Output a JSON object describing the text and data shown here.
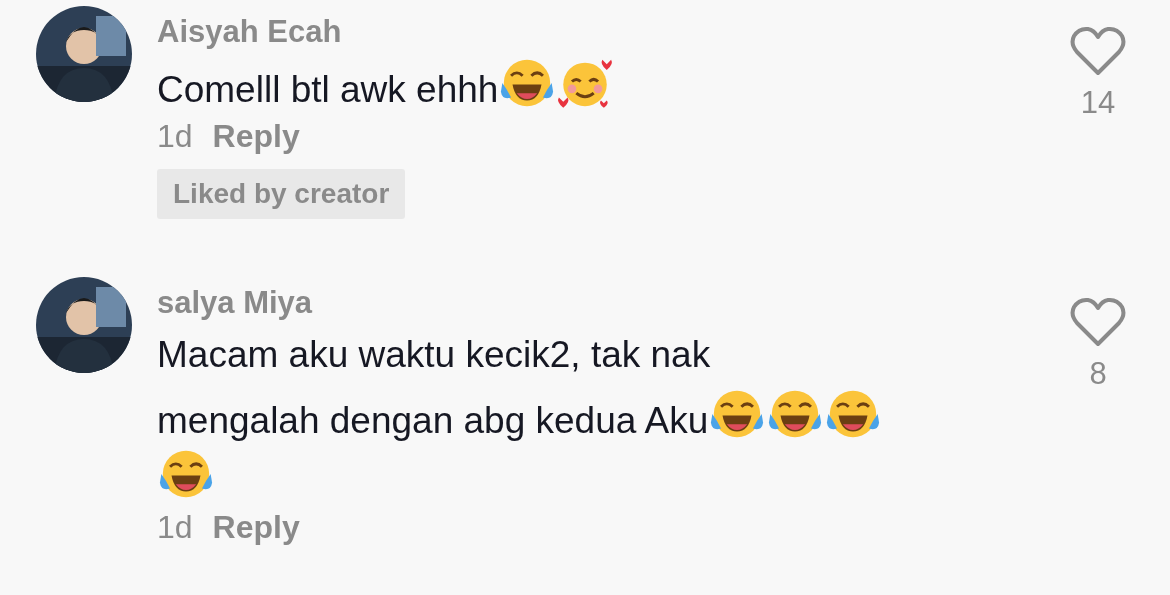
{
  "comments": [
    {
      "author": "Aisyah Ecah",
      "lines": [
        {
          "text": "Comelll btl awk ehhh",
          "emojis": [
            {
              "kind": "tears_of_joy"
            },
            {
              "kind": "smiling_hearts"
            }
          ]
        }
      ],
      "time": "1d",
      "reply": "Reply",
      "badge": "Liked by creator",
      "likes": "14",
      "avatar": {
        "kind": "picture"
      }
    },
    {
      "author": "salya Miya",
      "lines": [
        {
          "text": "Macam aku waktu kecik2, tak nak"
        },
        {
          "text": "mengalah dengan abg kedua Aku",
          "emojis": [
            {
              "kind": "tears_of_joy"
            },
            {
              "kind": "tears_of_joy"
            },
            {
              "kind": "tears_of_joy"
            }
          ]
        },
        {
          "emojis": [
            {
              "kind": "tears_of_joy"
            }
          ]
        }
      ],
      "time": "1d",
      "reply": "Reply",
      "likes": "8",
      "avatar": {
        "kind": "picture"
      }
    }
  ]
}
